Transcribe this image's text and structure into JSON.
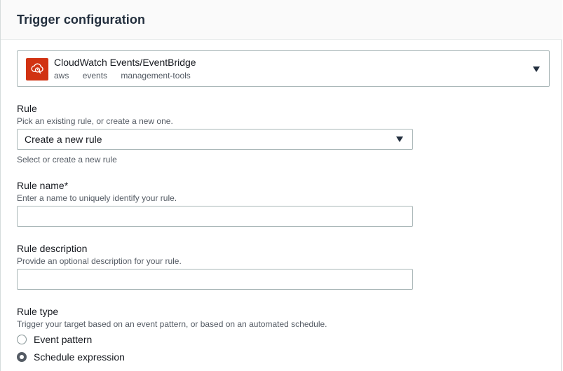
{
  "section": {
    "title": "Trigger configuration"
  },
  "trigger": {
    "service_name": "CloudWatch Events/EventBridge",
    "tags": [
      "aws",
      "events",
      "management-tools"
    ],
    "icon": "cloudwatch-events-icon",
    "icon_color": "#d13212"
  },
  "rule": {
    "label": "Rule",
    "description": "Pick an existing rule, or create a new one.",
    "selected": "Create a new rule",
    "hint": "Select or create a new rule"
  },
  "rule_name": {
    "label": "Rule name*",
    "description": "Enter a name to uniquely identify your rule.",
    "value": ""
  },
  "rule_description": {
    "label": "Rule description",
    "description": "Provide an optional description for your rule.",
    "value": ""
  },
  "rule_type": {
    "label": "Rule type",
    "description": "Trigger your target based on an event pattern, or based on an automated schedule.",
    "options": [
      {
        "label": "Event pattern",
        "checked": false
      },
      {
        "label": "Schedule expression",
        "checked": true
      }
    ]
  }
}
